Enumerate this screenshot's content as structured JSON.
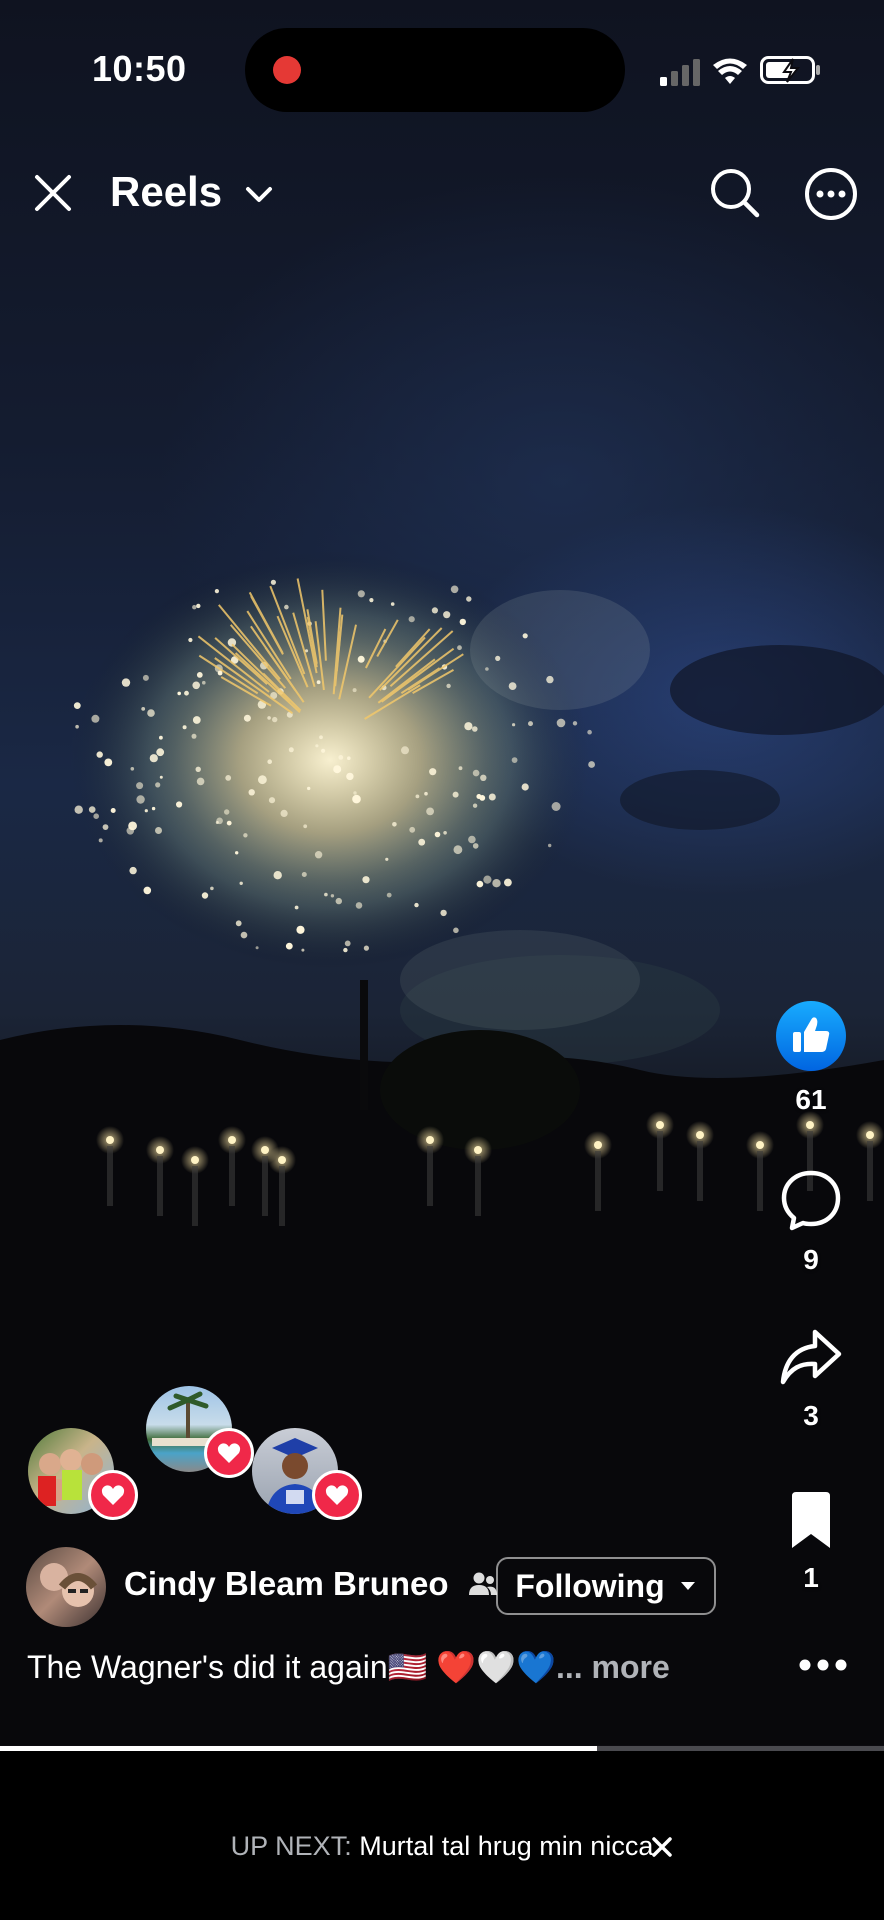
{
  "status_bar": {
    "time": "10:50"
  },
  "header": {
    "title": "Reels"
  },
  "actions": {
    "likes": "61",
    "comments": "9",
    "shares": "3",
    "saves": "1"
  },
  "post": {
    "author": "Cindy Bleam Bruneo",
    "follow_label": "Following",
    "caption": "The Wagner's did it again🇺🇸  ❤️🤍💙",
    "more_label": "... more",
    "progress": 0.675
  },
  "up_next": {
    "label": "UP NEXT:",
    "title": "Murtal tal hrug min nicca"
  },
  "colors": {
    "like_blue": "#1877f2",
    "heart_red": "#f02849",
    "record_dot": "#e53935"
  }
}
